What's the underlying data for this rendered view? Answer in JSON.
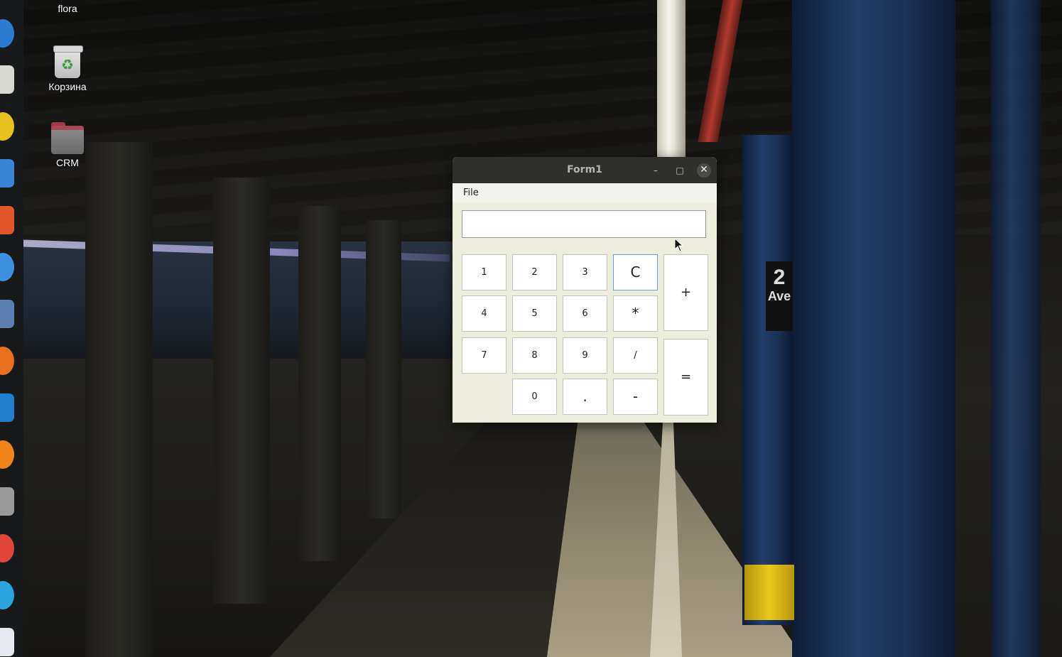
{
  "desktop": {
    "icons": [
      {
        "label": "flora",
        "icon": "folder-icon"
      },
      {
        "label": "Корзина",
        "icon": "trash-icon"
      },
      {
        "label": "CRM",
        "icon": "folder-icon"
      }
    ],
    "wallpaper_sign": {
      "line1": "2",
      "line2": "Ave"
    }
  },
  "dock": {
    "items": [
      "thunderbird-icon",
      "files-icon",
      "rhythmbox-icon",
      "libreoffice-writer-icon",
      "software-center-icon",
      "help-icon",
      "settings-icon",
      "firefox-icon",
      "vscode-icon",
      "app-icon",
      "monitor-icon",
      "chrome-icon",
      "telegram-icon",
      "text-editor-icon"
    ]
  },
  "window": {
    "title": "Form1",
    "minimize_symbol": "–",
    "maximize_symbol": "□",
    "close_symbol": "✕",
    "menu": {
      "file": "File"
    },
    "display_value": "",
    "keys": {
      "k1": "1",
      "k2": "2",
      "k3": "3",
      "clear": "C",
      "plus": "+",
      "k4": "4",
      "k5": "5",
      "k6": "6",
      "multiply": "*",
      "k7": "7",
      "k8": "8",
      "k9": "9",
      "divide": "/",
      "equals": "=",
      "k0": "0",
      "dot": ".",
      "minus": "-"
    }
  },
  "colors": {
    "window_bg": "#ededde",
    "titlebar": "#2f2f2d",
    "focus_border": "#6a9ed9"
  }
}
